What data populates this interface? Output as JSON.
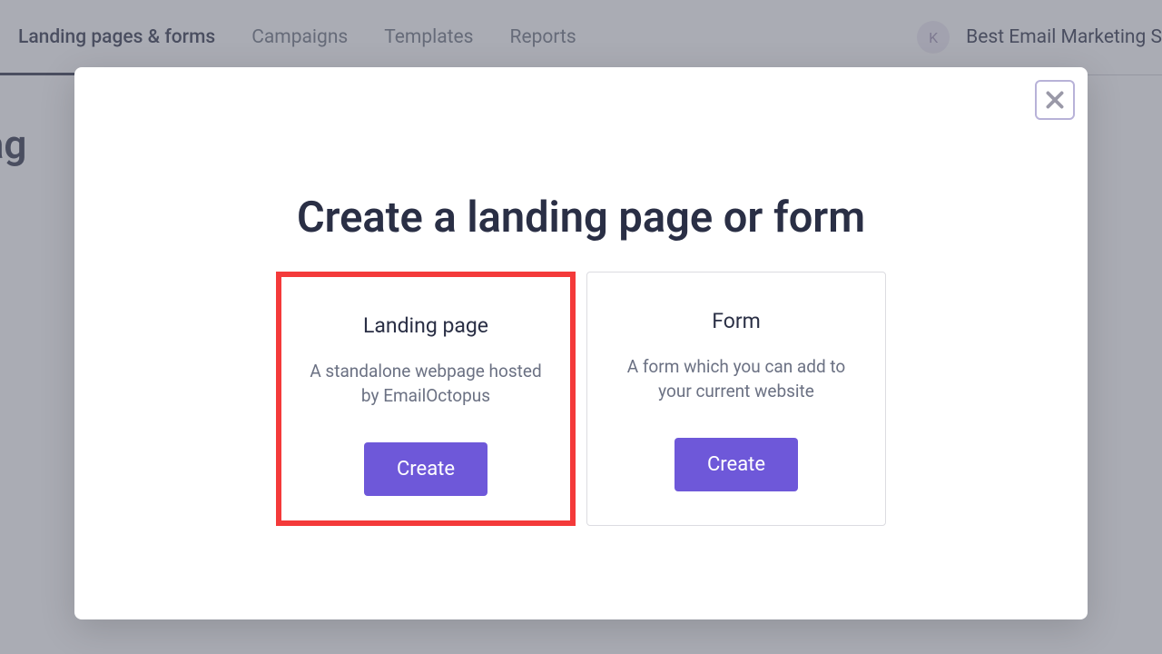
{
  "nav": {
    "items": [
      {
        "label": "Landing pages & forms",
        "active": true
      },
      {
        "label": "Campaigns",
        "active": false
      },
      {
        "label": "Templates",
        "active": false
      },
      {
        "label": "Reports",
        "active": false
      }
    ],
    "avatar_letter": "K",
    "account_name": "Best Email Marketing S"
  },
  "page": {
    "title": "g pag"
  },
  "modal": {
    "title": "Create a landing page or form",
    "cards": [
      {
        "title": "Landing page",
        "description": "A standalone webpage hosted by EmailOctopus",
        "button": "Create",
        "highlighted": true
      },
      {
        "title": "Form",
        "description": "A form which you can add to your current website",
        "button": "Create",
        "highlighted": false
      }
    ]
  },
  "colors": {
    "accent": "#6e58d9",
    "highlight": "#f43a3a",
    "text_dark": "#2a2f45",
    "text_muted": "#6b7183"
  }
}
